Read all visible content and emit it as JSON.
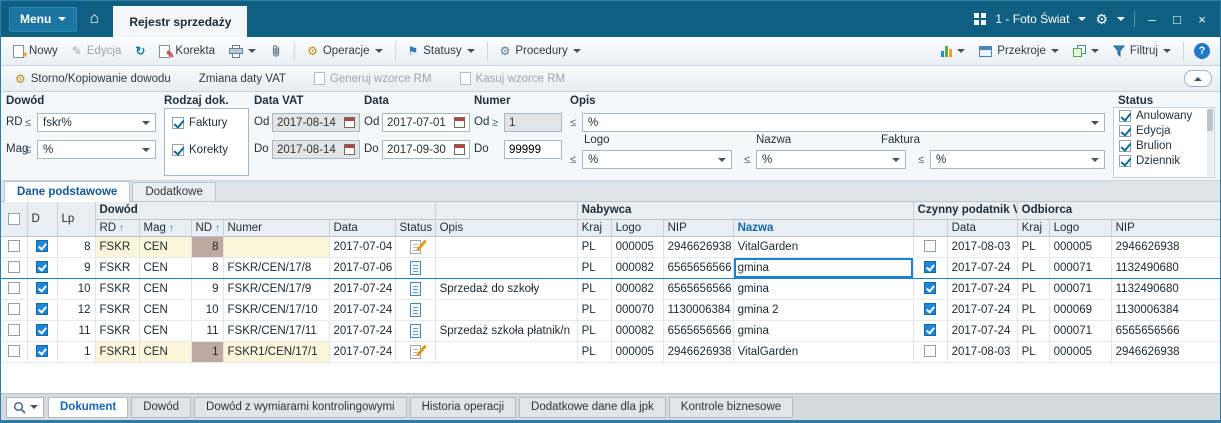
{
  "icons": {
    "home": "⌂",
    "gear": "⚙",
    "refresh": "↻",
    "pencil": "✎",
    "flag": "⚑",
    "plus": "+",
    "help": "?",
    "minimize": "–",
    "maximize": "□",
    "close": "×",
    "sort": "↑"
  },
  "window": {
    "menu_label": "Menu",
    "tab_label": "Rejestr sprzedaży",
    "company_label": "1 - Foto Świat"
  },
  "toolbar": {
    "nowy": "Nowy",
    "edycja": "Edycja",
    "korekta": "Korekta",
    "operacje": "Operacje",
    "statusy": "Statusy",
    "procedury": "Procedury",
    "przekroje": "Przekroje",
    "filtruj": "Filtruj"
  },
  "toolbar2": {
    "storno": "Storno/Kopiowanie dowodu",
    "zmiana": "Zmiana daty VAT",
    "generuj": "Generuj wzorce RM",
    "kasuj": "Kasuj wzorce RM"
  },
  "filters": {
    "dowod_label": "Dowód",
    "rd_label": "RD",
    "rd_value": "fskr%",
    "mag_label": "Mag",
    "mag_value": "%",
    "le_op": "≤",
    "ge_op": "≥",
    "rodzaj_label": "Rodzaj dok.",
    "faktury_label": "Faktury",
    "korekty_label": "Korekty",
    "data_vat_label": "Data VAT",
    "od_label": "Od",
    "do_label": "Do",
    "data_vat_od": "2017-08-14",
    "data_vat_do": "2017-08-14",
    "data_label": "Data",
    "data_od": "2017-07-01",
    "data_do": "2017-09-30",
    "numer_label": "Numer",
    "numer_od": "1",
    "numer_do": "99999",
    "opis_label": "Opis",
    "opis_value": "%",
    "logo_label": "Logo",
    "logo_value": "%",
    "nazwa_label": "Nazwa",
    "nazwa_value": "%",
    "faktura_label": "Faktura",
    "faktura_value": "%",
    "status_label": "Status",
    "status_items": [
      {
        "label": "Anulowany",
        "checked": true
      },
      {
        "label": "Edycja",
        "checked": true
      },
      {
        "label": "Brulion",
        "checked": true
      },
      {
        "label": "Dziennik",
        "checked": true
      }
    ]
  },
  "tabs": {
    "dane": "Dane podstawowe",
    "dodatkowe": "Dodatkowe"
  },
  "grid": {
    "groups": {
      "dowod": "Dowód",
      "nabywca": "Nabywca",
      "czynny": "Czynny podatnik VAT",
      "odbiorca": "Odbiorca"
    },
    "cols": {
      "d": "D",
      "lp": "Lp",
      "rd": "RD",
      "mag": "Mag",
      "nd": "ND",
      "numer": "Numer",
      "data": "Data",
      "status": "Status",
      "opis": "Opis",
      "kraj": "Kraj",
      "logo": "Logo",
      "nip": "NIP",
      "nazwa": "Nazwa",
      "vat_data": "Data",
      "o_kraj": "Kraj",
      "o_logo": "Logo",
      "o_nip": "NIP"
    },
    "rows": [
      {
        "selected": false,
        "highlight": true,
        "d": true,
        "lp": "8",
        "rd": "FSKR",
        "mag": "CEN",
        "nd": "8",
        "numer": "",
        "data": "2017-07-04",
        "status": "edit",
        "opis": "",
        "kraj": "PL",
        "logo": "000005",
        "nip": "2946626938",
        "nazwa": "VitalGarden",
        "vat": false,
        "vat_data": "2017-08-03",
        "o_kraj": "PL",
        "o_logo": "000005",
        "o_nip": "2946626938"
      },
      {
        "selected": true,
        "highlight": false,
        "d": true,
        "lp": "9",
        "rd": "FSKR",
        "mag": "CEN",
        "nd": "8",
        "numer": "FSKR/CEN/17/8",
        "data": "2017-07-06",
        "status": "doc",
        "opis": "",
        "kraj": "PL",
        "logo": "000082",
        "nip": "6565656566",
        "nazwa": "gmina",
        "vat": true,
        "vat_data": "2017-07-24",
        "o_kraj": "PL",
        "o_logo": "000071",
        "o_nip": "1132490680"
      },
      {
        "selected": false,
        "highlight": false,
        "d": true,
        "lp": "10",
        "rd": "FSKR",
        "mag": "CEN",
        "nd": "9",
        "numer": "FSKR/CEN/17/9",
        "data": "2017-07-24",
        "status": "doc",
        "opis": "Sprzedaż do szkoły",
        "kraj": "PL",
        "logo": "000082",
        "nip": "6565656566",
        "nazwa": "gmina",
        "vat": true,
        "vat_data": "2017-07-24",
        "o_kraj": "PL",
        "o_logo": "000071",
        "o_nip": "1132490680"
      },
      {
        "selected": false,
        "highlight": false,
        "d": true,
        "lp": "12",
        "rd": "FSKR",
        "mag": "CEN",
        "nd": "10",
        "numer": "FSKR/CEN/17/10",
        "data": "2017-07-24",
        "status": "doc",
        "opis": "",
        "kraj": "PL",
        "logo": "000070",
        "nip": "1130006384",
        "nazwa": "gmina 2",
        "vat": true,
        "vat_data": "2017-07-24",
        "o_kraj": "PL",
        "o_logo": "000069",
        "o_nip": "1130006384"
      },
      {
        "selected": false,
        "highlight": false,
        "d": true,
        "lp": "11",
        "rd": "FSKR",
        "mag": "CEN",
        "nd": "11",
        "numer": "FSKR/CEN/17/11",
        "data": "2017-07-24",
        "status": "doc",
        "opis": "Sprzedaż szkoła płatnik/n",
        "kraj": "PL",
        "logo": "000082",
        "nip": "6565656566",
        "nazwa": "gmina",
        "vat": true,
        "vat_data": "2017-07-24",
        "o_kraj": "PL",
        "o_logo": "000071",
        "o_nip": "6565656566"
      },
      {
        "selected": false,
        "highlight": true,
        "d": true,
        "lp": "1",
        "rd": "FSKR1",
        "mag": "CEN",
        "nd": "1",
        "numer": "FSKR1/CEN/17/1",
        "data": "2017-07-24",
        "status": "edit",
        "opis": "",
        "kraj": "PL",
        "logo": "000005",
        "nip": "2946626938",
        "nazwa": "VitalGarden",
        "vat": false,
        "vat_data": "2017-08-03",
        "o_kraj": "PL",
        "o_logo": "000005",
        "o_nip": "2946626938"
      }
    ]
  },
  "footer": {
    "tabs": [
      {
        "label": "Dokument",
        "active": true
      },
      {
        "label": "Dowód",
        "active": false
      },
      {
        "label": "Dowód z wymiarami kontrolingowymi",
        "active": false
      },
      {
        "label": "Historia operacji",
        "active": false
      },
      {
        "label": "Dodatkowe dane dla jpk",
        "active": false
      },
      {
        "label": "Kontrole biznesowe",
        "active": false
      }
    ]
  }
}
